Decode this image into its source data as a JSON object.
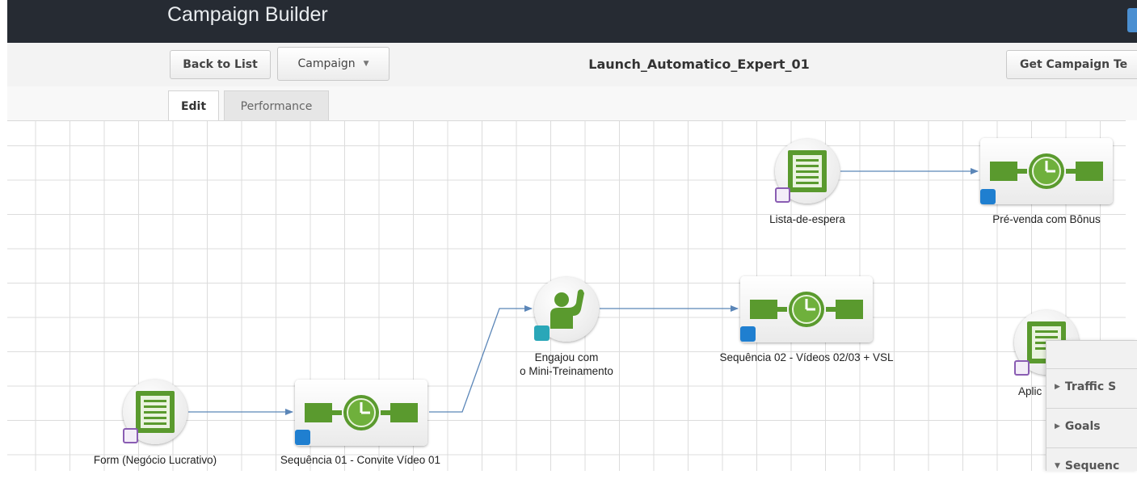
{
  "app": {
    "title": "Campaign Builder"
  },
  "toolbar": {
    "back_label": "Back to List",
    "campaign_menu_label": "Campaign",
    "campaign_name": "Launch_Automatico_Expert_01",
    "get_template_label": "Get Campaign Te"
  },
  "tabs": [
    {
      "label": "Edit",
      "active": true
    },
    {
      "label": "Performance",
      "active": false
    }
  ],
  "nodes": {
    "lista": {
      "label": "Lista-de-espera",
      "type": "web-form",
      "icon": "form-icon"
    },
    "prevenda": {
      "label": "Pré-venda com Bônus",
      "type": "sequence",
      "icon": "sequence-timer-icon"
    },
    "engajou": {
      "label_line1": "Engajou com",
      "label_line2": "o Mini-Treinamento",
      "type": "goal",
      "icon": "raised-hand-icon"
    },
    "seq02": {
      "label": "Sequência 02 - Vídeos 02/03 + VSL",
      "type": "sequence",
      "icon": "sequence-timer-icon"
    },
    "aplic": {
      "label": "Aplic",
      "type": "web-form",
      "icon": "form-icon"
    },
    "form": {
      "label": "Form (Negócio Lucrativo)",
      "type": "web-form",
      "icon": "form-icon"
    },
    "seq01": {
      "label": "Sequência 01 - Convite Vídeo 01",
      "type": "sequence",
      "icon": "sequence-timer-icon"
    }
  },
  "side_panel": {
    "items": [
      {
        "label": "Traffic S",
        "expanded": false
      },
      {
        "label": "Goals",
        "expanded": false
      },
      {
        "label": "Sequenc",
        "expanded": true
      }
    ]
  },
  "colors": {
    "header_bg": "#262b33",
    "node_green": "#5a9a2e",
    "connector": "#5b86b8",
    "sequence_badge": "#1f7fd0",
    "form_badge": "#8a5db3",
    "goal_badge": "#2aa7b8"
  }
}
